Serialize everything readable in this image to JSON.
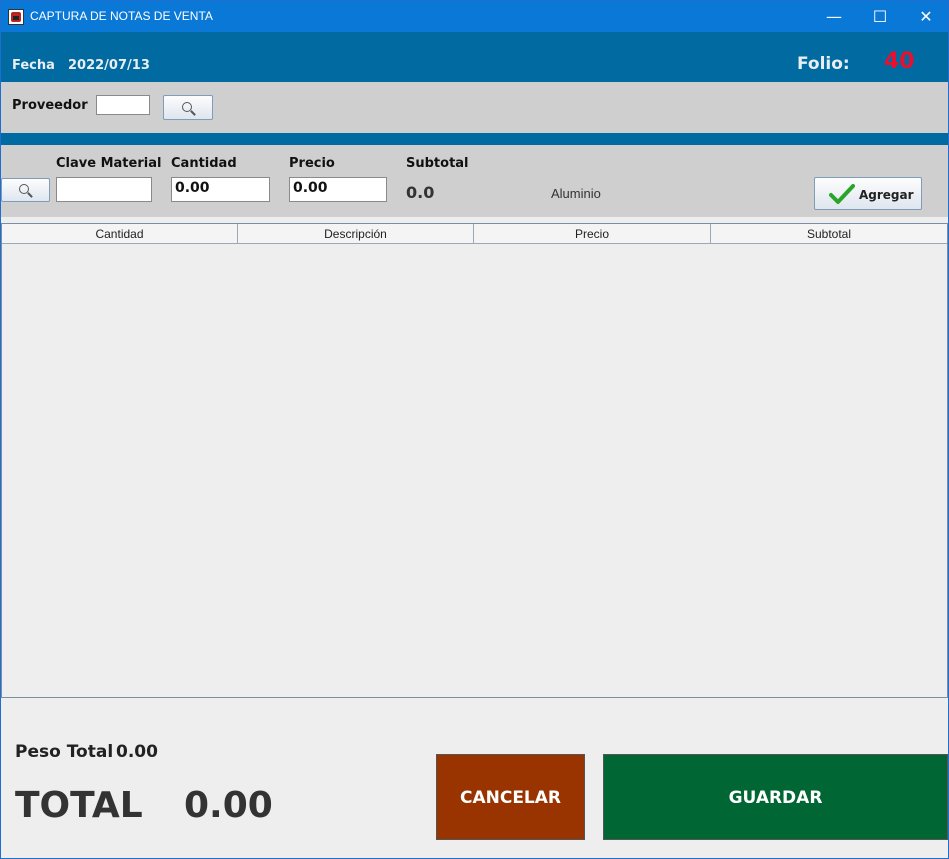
{
  "window": {
    "title": "CAPTURA DE NOTAS DE VENTA",
    "minimize": "—",
    "maximize": "☐",
    "close": "✕"
  },
  "header": {
    "fecha_label": "Fecha",
    "fecha_value": "2022/07/13",
    "folio_label": "Folio:",
    "folio_value": "40"
  },
  "proveedor": {
    "label": "Proveedor",
    "value": ""
  },
  "entry": {
    "clave_label": "Clave Material",
    "clave_value": "",
    "cantidad_label": "Cantidad",
    "cantidad_value": "0.00",
    "precio_label": "Precio",
    "precio_value": "0.00",
    "subtotal_label": "Subtotal",
    "subtotal_value": "0.0",
    "material_name": "Aluminio",
    "agregar_label": "Agregar"
  },
  "table": {
    "columns": [
      "Cantidad",
      "Descripción",
      "Precio",
      "Subtotal"
    ],
    "rows": []
  },
  "footer": {
    "peso_label": "Peso Total",
    "peso_value": "0.00",
    "total_label": "TOTAL",
    "total_value": "0.00",
    "cancelar_label": "CANCELAR",
    "guardar_label": "GUARDAR"
  },
  "colors": {
    "title_bar": "#0a78d7",
    "header": "#006aa1",
    "folio": "#e8102e",
    "cancel": "#993300",
    "save": "#006633"
  }
}
